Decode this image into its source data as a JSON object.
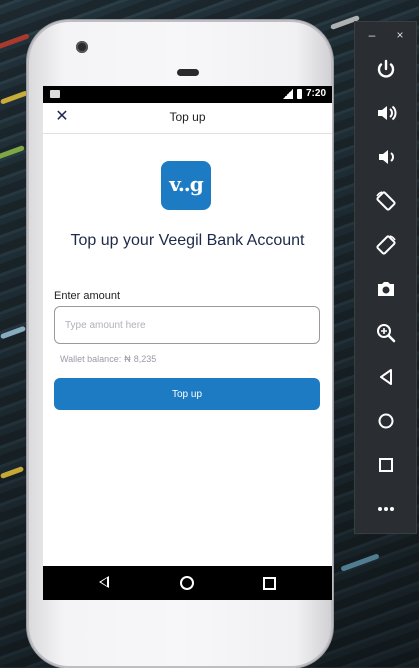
{
  "screen": {
    "status_time": "7:20",
    "appbar": {
      "title": "Top up",
      "close_icon": "close-icon"
    },
    "logo_text": "v..g",
    "headline": "Top up your Veegil Bank Account",
    "form": {
      "amount_label": "Enter amount",
      "amount_placeholder": "Type amount here",
      "amount_value": "",
      "balance_label": "Wallet balance:",
      "balance_currency_icon": "currency-icon",
      "balance_amount": "8,235",
      "submit_label": "Top up"
    }
  },
  "colors": {
    "accent": "#1d7bc4",
    "title_text": "#1e2a4a"
  },
  "emulator_toolbar": {
    "minimize_label": "–",
    "close_label": "×",
    "buttons": [
      "power-icon",
      "volume-up-icon",
      "volume-down-icon",
      "rotate-left-icon",
      "rotate-right-icon",
      "camera-icon",
      "zoom-icon",
      "back-icon",
      "home-icon",
      "overview-icon",
      "more-icon"
    ]
  }
}
